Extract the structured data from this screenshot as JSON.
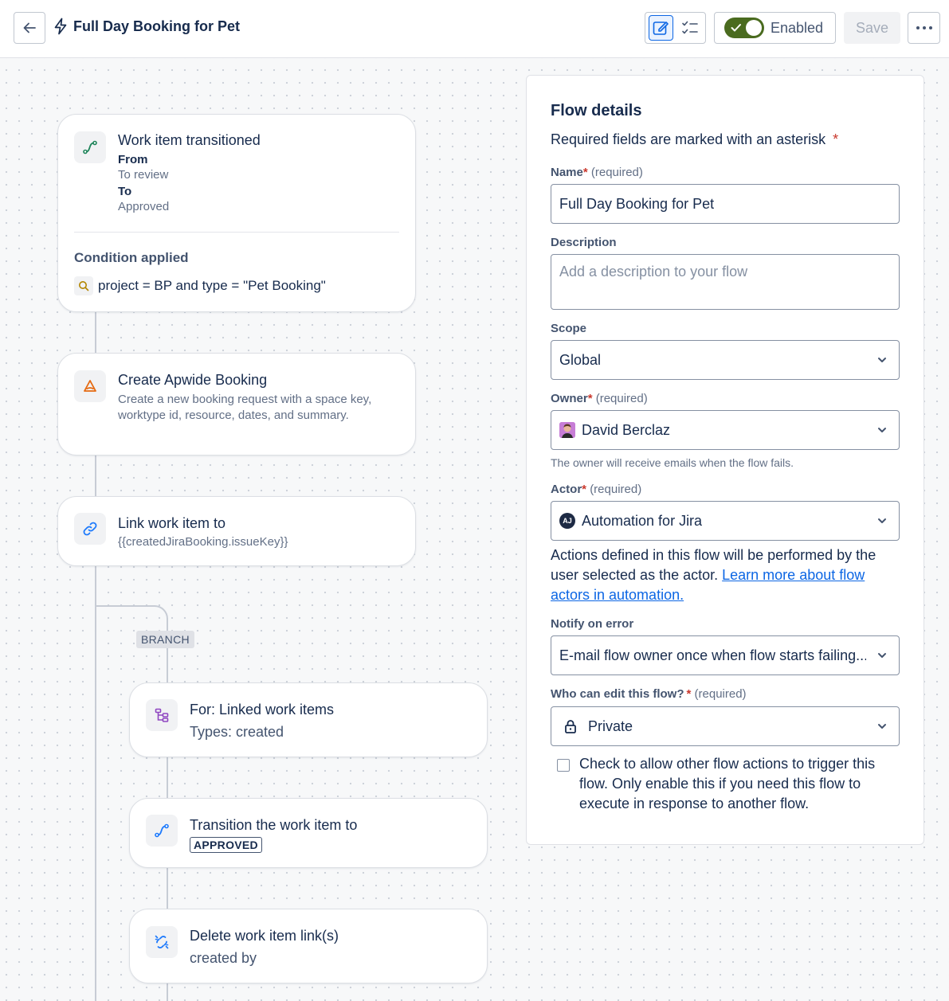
{
  "header": {
    "title": "Full Day Booking for Pet",
    "enabled_label": "Enabled",
    "save_label": "Save"
  },
  "trigger": {
    "title": "Work item transitioned",
    "from_label": "From",
    "from_value": "To review",
    "to_label": "To",
    "to_value": "Approved",
    "condition_title": "Condition applied",
    "condition": "project = BP and type = \"Pet Booking\""
  },
  "actions": [
    {
      "title": "Create Apwide Booking",
      "description": "Create a new booking request with a space key, worktype id, resource, dates, and summary."
    },
    {
      "title": "Link work item to",
      "description": "{{createdJiraBooking.issueKey}}"
    }
  ],
  "branch": {
    "tag": "BRANCH",
    "items": [
      {
        "title": "For: Linked work items",
        "description": "Types: created"
      },
      {
        "title": "Transition the work item to",
        "lozenge": "APPROVED"
      },
      {
        "title": "Delete work item link(s)",
        "description": "created by"
      }
    ]
  },
  "details": {
    "title": "Flow details",
    "intro": "Required fields are marked with an asterisk",
    "star": "*",
    "required_hint": "(required)",
    "name_label": "Name",
    "name_value": "Full Day Booking for Pet",
    "description_label": "Description",
    "description_placeholder": "Add a description to your flow",
    "scope_label": "Scope",
    "scope_value": "Global",
    "owner_label": "Owner",
    "owner_value": "David Berclaz",
    "owner_help": "The owner will receive emails when the flow fails.",
    "actor_label": "Actor",
    "actor_initials": "AJ",
    "actor_value": "Automation for Jira",
    "actor_text": "Actions defined in this flow will be performed by the user selected as the actor.",
    "actor_link": "Learn more about flow actors in automation.",
    "notify_label": "Notify on error",
    "notify_value": "E-mail flow owner once when flow starts failing...",
    "who_edit_label": "Who can edit this flow?",
    "who_edit_value": "Private",
    "checkbox_text": "Check to allow other flow actions to trigger this flow. Only enable this if you need this flow to execute in response to another flow."
  },
  "colors": {
    "accent": "#0c66e4",
    "toggle_on": "#4a6b1f",
    "required": "#c9372c",
    "trigger_icon": "#1f845a",
    "apwide_icon": "#e56910",
    "link_icon": "#1d7afc",
    "branch_icon": "#8f46c1"
  },
  "icons": {
    "back": "arrow-left-icon",
    "bolt": "lightning-bolt-icon",
    "edit": "edit-pencil-icon",
    "checklist": "checklist-icon",
    "more": "more-horizontal-icon",
    "trigger": "transition-icon",
    "search": "search-icon",
    "apwide": "apwide-logo-icon",
    "link": "link-icon",
    "branch": "branch-icon",
    "chevron": "chevron-down-icon",
    "lock": "lock-icon",
    "unlink": "unlink-icon"
  }
}
